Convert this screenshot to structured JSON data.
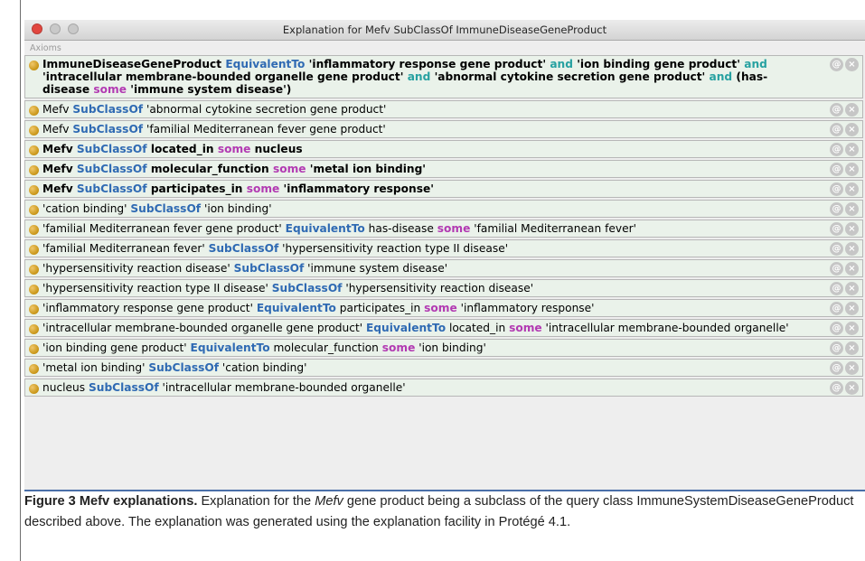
{
  "window": {
    "title": "Explanation for Mefv SubClassOf ImmuneDiseaseGeneProduct",
    "section_label": "Axioms",
    "control_icons": [
      "annotate-icon",
      "delete-icon"
    ]
  },
  "colors": {
    "keyword_blue": "#2f6ab3",
    "keyword_teal": "#27a1a1",
    "keyword_magenta": "#b23ab2",
    "bullet": "#d9a52b"
  },
  "axioms": [
    {
      "bold": true,
      "segments": [
        {
          "t": "ImmuneDiseaseGeneProduct "
        },
        {
          "t": "EquivalentTo",
          "k": "blue"
        },
        {
          "t": " 'inflammatory response gene product' "
        },
        {
          "t": "and",
          "k": "teal"
        },
        {
          "t": " 'ion binding gene product' "
        },
        {
          "t": "and",
          "k": "teal"
        },
        {
          "t": " 'intracellular membrane-bounded organelle gene product' "
        },
        {
          "t": "and",
          "k": "teal"
        },
        {
          "t": " 'abnormal cytokine secretion gene product' "
        },
        {
          "t": "and",
          "k": "teal"
        },
        {
          "t": " (has-disease "
        },
        {
          "t": "some",
          "k": "mag"
        },
        {
          "t": " 'immune system disease')"
        }
      ]
    },
    {
      "bold": false,
      "segments": [
        {
          "t": "Mefv "
        },
        {
          "t": "SubClassOf",
          "k": "blue"
        },
        {
          "t": " 'abnormal cytokine secretion gene product'"
        }
      ]
    },
    {
      "bold": false,
      "segments": [
        {
          "t": "Mefv "
        },
        {
          "t": "SubClassOf",
          "k": "blue"
        },
        {
          "t": " 'familial Mediterranean fever gene product'"
        }
      ]
    },
    {
      "bold": true,
      "segments": [
        {
          "t": "Mefv "
        },
        {
          "t": "SubClassOf",
          "k": "blue"
        },
        {
          "t": " located_in "
        },
        {
          "t": "some",
          "k": "mag"
        },
        {
          "t": " nucleus"
        }
      ]
    },
    {
      "bold": true,
      "segments": [
        {
          "t": "Mefv "
        },
        {
          "t": "SubClassOf",
          "k": "blue"
        },
        {
          "t": " molecular_function "
        },
        {
          "t": "some",
          "k": "mag"
        },
        {
          "t": " 'metal ion binding'"
        }
      ]
    },
    {
      "bold": true,
      "segments": [
        {
          "t": "Mefv "
        },
        {
          "t": "SubClassOf",
          "k": "blue"
        },
        {
          "t": " participates_in "
        },
        {
          "t": "some",
          "k": "mag"
        },
        {
          "t": " 'inflammatory response'"
        }
      ]
    },
    {
      "bold": false,
      "segments": [
        {
          "t": "'cation binding' "
        },
        {
          "t": "SubClassOf",
          "k": "blue"
        },
        {
          "t": " 'ion binding'"
        }
      ]
    },
    {
      "bold": false,
      "segments": [
        {
          "t": "'familial Mediterranean fever gene product' "
        },
        {
          "t": "EquivalentTo",
          "k": "blue"
        },
        {
          "t": " has-disease "
        },
        {
          "t": "some",
          "k": "mag"
        },
        {
          "t": " 'familial Mediterranean fever'"
        }
      ]
    },
    {
      "bold": false,
      "segments": [
        {
          "t": "'familial Mediterranean fever' "
        },
        {
          "t": "SubClassOf",
          "k": "blue"
        },
        {
          "t": " 'hypersensitivity reaction type II disease'"
        }
      ]
    },
    {
      "bold": false,
      "segments": [
        {
          "t": "'hypersensitivity reaction disease' "
        },
        {
          "t": "SubClassOf",
          "k": "blue"
        },
        {
          "t": " 'immune system disease'"
        }
      ]
    },
    {
      "bold": false,
      "segments": [
        {
          "t": "'hypersensitivity reaction type II disease' "
        },
        {
          "t": "SubClassOf",
          "k": "blue"
        },
        {
          "t": " 'hypersensitivity reaction disease'"
        }
      ]
    },
    {
      "bold": false,
      "segments": [
        {
          "t": "'inflammatory response gene product' "
        },
        {
          "t": "EquivalentTo",
          "k": "blue"
        },
        {
          "t": " participates_in "
        },
        {
          "t": "some",
          "k": "mag"
        },
        {
          "t": " 'inflammatory response'"
        }
      ]
    },
    {
      "bold": false,
      "segments": [
        {
          "t": "'intracellular membrane-bounded organelle gene product' "
        },
        {
          "t": "EquivalentTo",
          "k": "blue"
        },
        {
          "t": " located_in "
        },
        {
          "t": "some",
          "k": "mag"
        },
        {
          "t": " 'intracellular membrane-bounded organelle'"
        }
      ]
    },
    {
      "bold": false,
      "segments": [
        {
          "t": "'ion binding gene product' "
        },
        {
          "t": "EquivalentTo",
          "k": "blue"
        },
        {
          "t": " molecular_function "
        },
        {
          "t": "some",
          "k": "mag"
        },
        {
          "t": " 'ion binding'"
        }
      ]
    },
    {
      "bold": false,
      "segments": [
        {
          "t": "'metal ion binding' "
        },
        {
          "t": "SubClassOf",
          "k": "blue"
        },
        {
          "t": " 'cation binding'"
        }
      ]
    },
    {
      "bold": false,
      "segments": [
        {
          "t": "nucleus "
        },
        {
          "t": "SubClassOf",
          "k": "blue"
        },
        {
          "t": " 'intracellular membrane-bounded organelle'"
        }
      ]
    }
  ],
  "caption": {
    "label": "Figure 3 Mefv explanations.",
    "text_1": " Explanation for the ",
    "gene": "Mefv",
    "text_2": " gene product being a subclass of the query class ImmuneSystemDiseaseGeneProduct described above. The explanation was generated using the explanation facility in Protégé 4.1."
  }
}
